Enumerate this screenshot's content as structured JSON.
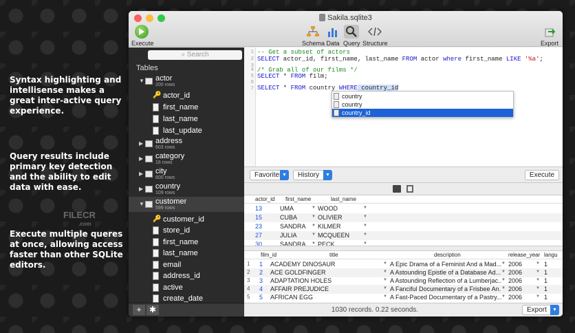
{
  "promo": {
    "p1": "Syntax highlighting and intellisense makes a great inter-active query experience.",
    "p2": "Query results include primary key detection and the ability to edit data with ease.",
    "p3": "Execute multiple queres at once, allowing access faster than other SQLite editors."
  },
  "watermark": {
    "main": "FILECR",
    "sub": ".com"
  },
  "window": {
    "title": "Sakila.sqlite3"
  },
  "toolbar": {
    "execute": "Execute",
    "schema": "Schema",
    "data": "Data",
    "query": "Query",
    "structure": "Structure",
    "export": "Export"
  },
  "sidebar": {
    "search_placeholder": "Search",
    "title": "Tables",
    "actor": {
      "name": "actor",
      "rows": "200 rows",
      "cols": [
        "actor_id",
        "first_name",
        "last_name",
        "last_update"
      ]
    },
    "address": {
      "name": "address",
      "rows": "603 rows"
    },
    "category": {
      "name": "category",
      "rows": "16 rows"
    },
    "city": {
      "name": "city",
      "rows": "600 rows"
    },
    "country": {
      "name": "country",
      "rows": "109 rows"
    },
    "customer": {
      "name": "customer",
      "rows": "599 rows",
      "cols": [
        "customer_id",
        "store_id",
        "first_name",
        "last_name",
        "email",
        "address_id",
        "active",
        "create_date"
      ]
    },
    "add": "+"
  },
  "editor": {
    "lines": [
      "1",
      "2",
      "3",
      "4",
      "5",
      "6",
      "7"
    ],
    "l1": "-- Get a subset of actors",
    "l2a": "SELECT",
    "l2b": " actor_id, first_name, last_name ",
    "l2c": "FROM",
    "l2d": " actor ",
    "l2e": "where",
    "l2f": " first_name ",
    "l2g": "LIKE",
    "l2h": " ",
    "l2i": "'%a'",
    "l2j": ";",
    "l4": "/* Grab all of our films */",
    "l5a": "SELECT",
    "l5b": " * ",
    "l5c": "FROM",
    "l5d": " film;",
    "l7a": "SELECT",
    "l7b": " * ",
    "l7c": "FROM",
    "l7d": " country ",
    "l7e": "WHERE",
    "l7f": " country_id",
    "autocomplete": [
      "country",
      "country",
      "country_id"
    ]
  },
  "querybar": {
    "favorites": "Favorites",
    "history": "History",
    "execute": "Execute"
  },
  "results1": {
    "headers": [
      "actor_id",
      "first_name",
      "last_name"
    ],
    "rows": [
      [
        "13",
        "UMA",
        "WOOD"
      ],
      [
        "15",
        "CUBA",
        "OLIVIER"
      ],
      [
        "23",
        "SANDRA",
        "KILMER"
      ],
      [
        "27",
        "JULIA",
        "MCQUEEN"
      ],
      [
        "30",
        "SANDRA",
        "PECK"
      ]
    ]
  },
  "results2": {
    "headers": [
      "film_id",
      "title",
      "description",
      "release_year",
      "langu"
    ],
    "rows": [
      [
        "1",
        "1",
        "ACADEMY DINOSAUR",
        "A Epic Drama of a Feminist And a Mad...",
        "2006",
        "1"
      ],
      [
        "2",
        "2",
        "ACE GOLDFINGER",
        "A Astounding Epistle of a Database Ad...",
        "2006",
        "1"
      ],
      [
        "3",
        "3",
        "ADAPTATION HOLES",
        "A Astounding Reflection of a Lumberjac...",
        "2006",
        "1"
      ],
      [
        "4",
        "4",
        "AFFAIR PREJUDICE",
        "A Fanciful Documentary of a Frisbee An...",
        "2006",
        "1"
      ],
      [
        "5",
        "5",
        "AFRICAN EGG",
        "A Fast-Paced Documentary of a Pastry...",
        "2006",
        "1"
      ]
    ]
  },
  "footer": {
    "status": "1030 records. 0.22 seconds.",
    "export": "Export"
  },
  "colors": {
    "accent": "#2f7de0",
    "selection": "#1d62d6",
    "sidebar": "#2b2b2b"
  }
}
